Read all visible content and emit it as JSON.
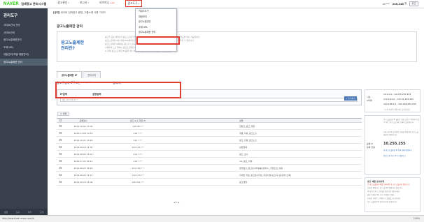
{
  "app": {
    "logo": "NAVER",
    "title": "검색광고 관리시스템"
  },
  "topnav": {
    "items": [
      {
        "label": "광고관리",
        "caret": "▾"
      },
      {
        "label": "보고서",
        "caret": "▾"
      },
      {
        "label": "비즈머니",
        "badge": "new"
      },
      {
        "label": "광고도구",
        "caret": "▾"
      }
    ]
  },
  "top_right": {
    "account": "mi***",
    "money": "246,248",
    "unit": "원",
    "charge": "충전"
  },
  "dropdown": {
    "items": [
      "키워드도구",
      "대량관리",
      "광고노출진단",
      "주제 URL",
      "광고노출제한 관리"
    ]
  },
  "sidebar": {
    "title": "관리도구",
    "items": [
      "사이트관리 관리",
      "사이트관리",
      "광고노출제한관리",
      "주제 URL",
      "대량관리(엑셀 대량관리)",
      "광고노출제한 관리"
    ],
    "bottom": [
      "설정",
      "도구",
      "쿠키",
      "고객"
    ]
  },
  "notice": {
    "prefix": "[공지]",
    "text": "네이버 검색광고 동향, 그룹소재 사용 가이드"
  },
  "page": {
    "title": "광고노출제한 관리",
    "desc_title": "광고노출제한\n관리란?",
    "desc_lines": [
      "광고주 또는 대행사가 광고 노출을 원하지 않는 IP를 등록하여, 해당 IP에서 광고가 노출되지 않도록 하는 기능입니다.",
      "광고노출제한 IP는 최대 600개까지 등록할 수 있으며, 와일드카드(*) 형식으로 IP 대역을 등록할 수 있습니다.",
      "광고노출제한 IP에서는 광고가 노출되지 않으므로 클릭도 발생하지 않습니다.",
      "검색결과 노출 위치는 광고노출제한 IP 등록 여부와 관계없이 동일하게 산정됩니다.",
      "※ 현재 광고노출제한 IP 등록 개수 확인이 필요한 경우 고객센터로 문의해 주세요."
    ]
  },
  "tabs": [
    {
      "label": "광고노출제한 IP"
    },
    {
      "label": "관리이력"
    }
  ],
  "ip_info": {
    "prefix": "광고주님의 IP주소는",
    "ip": "*.***",
    "suffix": "입니다."
  },
  "input_area": {
    "col_ip": "IP입력",
    "col_memo": "설명입력",
    "placeholder": "예) 123.45.67.*",
    "add_button": "+ 추가하기"
  },
  "delete_button": "× 삭제",
  "table": {
    "headers": [
      "",
      "등록일시",
      "광고 노출 제한 IP",
      "설명"
    ],
    "rows": [
      {
        "date": "2014.12.02 17:00",
        "ip": "115.95.*.*",
        "memo": "한달간_광고_제한"
      },
      {
        "date": "2014.11.28 10:33",
        "ip": "118.*.*.*",
        "memo": "개발_리뷰_광고노출"
      },
      {
        "date": "2014.10.21 13:48",
        "ip": "121.*.*.*",
        "memo": "광고_리뷰_광고노출"
      },
      {
        "date": "2014.09.10 11:35",
        "ip": "223.131.*.*",
        "memo": "상담업체"
      },
      {
        "date": "2014.08.05 15:03",
        "ip": "211.*.*.*",
        "memo": "광고_검수"
      },
      {
        "date": "2014.07.22 09:12",
        "ip": "114.*.*.*",
        "memo": "ms_광고_리뷰"
      },
      {
        "date": "2014.06.27 08:48",
        "ip": "221.150.*.*",
        "memo": "일주일간_광고모니터링중(조회수)_키워드조_이동"
      },
      {
        "date": "2014.06.20 11:22",
        "ip": "112.170.*.*",
        "memo": "자세한 자료_광고모니터링_지정사항(보고서) 중(임의 소재)"
      },
      {
        "date": "2014.05.13 15:06",
        "ip": "125.241.*.*",
        "memo": "광고대행"
      }
    ]
  },
  "pager": "◀ 1 ▶",
  "right": {
    "ip_box": {
      "label1": "사설",
      "label2": "IP대역",
      "ranges": [
        "10.0.0.0 - 10.255.255.255",
        "172.16.0.0 - 172.31.255.255",
        "192.168.0.0 - 192.168.255.255"
      ],
      "note": "* 사설 IP대역 제외하여 등록하세요."
    },
    "reg_box": {
      "label1": "등록 IP",
      "label2": "등록 현황",
      "para1": "광고노출제한 IP 설정은 계정 단위로 적용되며 일부 IP는 광고노출 제한 등록이 불가합니다.",
      "para2": "등록 개수와 상관없이 등록한 IP대역이 광고노출제한에 적용됩니다.",
      "big": "10.255.255",
      "links": [
        "내 광고노출제한 IP 등록 현황 확인하기",
        "최대 등록 가능 IP 수 확인하기"
      ]
    },
    "tip_box": {
      "title": "광고 제한 유의사항",
      "lines": [
        "주 광고노출제한 IP를 등록하면 광고가 노출되지 않습니다.",
        "등록한 IP에서는 광고 클릭이 발생하지 않습니다.",
        "IP 대역 등록 시 범위를 정확하게 확인하세요.",
        "잘못 등록된 IP는 즉시 삭제해 주세요.",
        "자세한 내용은 고객센터 도움말을 참고하세요.",
        "광고노출제한 IP 관리에 관한 안내입니다."
      ]
    }
  },
  "statusbar": {
    "url": "http://searchad.naver.com/#",
    "zoom": "100%"
  },
  "colors": {
    "sidebar": "#37404c",
    "accent_green": "#1ec800",
    "highlight_red": "#e03c31",
    "link_blue": "#2f6fbd"
  }
}
